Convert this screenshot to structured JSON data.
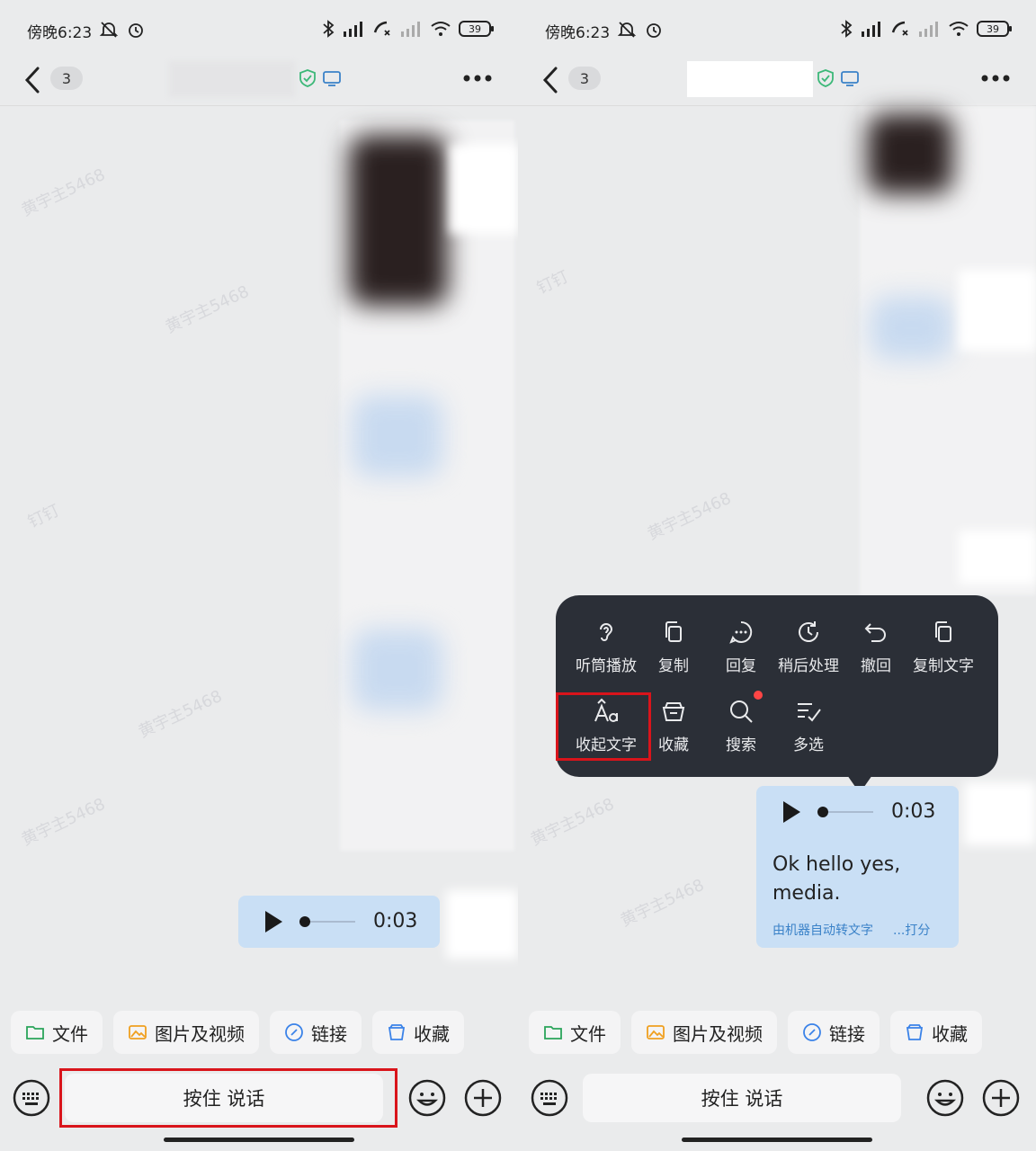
{
  "status_bar": {
    "time": "傍晚6:23",
    "battery": "39"
  },
  "nav": {
    "unread_count": "3"
  },
  "watermark": {
    "text": "黄宇主5468",
    "brand": "钉钉"
  },
  "shortcuts": [
    {
      "label": "文件",
      "icon": "folder-icon",
      "color": "#2aa45a"
    },
    {
      "label": "图片及视频",
      "icon": "image-icon",
      "color": "#f0a020"
    },
    {
      "label": "链接",
      "icon": "link-icon",
      "color": "#3a82e8"
    },
    {
      "label": "收藏",
      "icon": "favorites-icon",
      "color": "#3a82e8"
    }
  ],
  "input": {
    "hold_to_talk": "按住 说话"
  },
  "voice_message": {
    "duration": "0:03",
    "transcript": "Ok hello yes, media.",
    "transcript_line1": "Ok hello yes,",
    "transcript_line2": "media.",
    "caption_auto": "由机器自动转文字",
    "caption_rate": "...打分"
  },
  "context_menu": {
    "row1": [
      {
        "label": "听筒播放",
        "icon": "ear-icon"
      },
      {
        "label": "复制",
        "icon": "copy-icon"
      },
      {
        "label": "回复",
        "icon": "reply-icon"
      },
      {
        "label": "稍后处理",
        "icon": "later-icon"
      },
      {
        "label": "撤回",
        "icon": "undo-icon"
      },
      {
        "label": "复制文字",
        "icon": "copy-text-icon"
      }
    ],
    "row2": [
      {
        "label": "收起文字",
        "icon": "collapse-text-icon"
      },
      {
        "label": "收藏",
        "icon": "favorite-box-icon"
      },
      {
        "label": "搜索",
        "icon": "search-icon"
      },
      {
        "label": "多选",
        "icon": "multi-select-icon"
      }
    ]
  },
  "colors": {
    "highlight": "#d9141b",
    "bubble": "#c9dff5",
    "menu_bg": "#2b2f37",
    "accent_blue": "#3a82c8"
  }
}
